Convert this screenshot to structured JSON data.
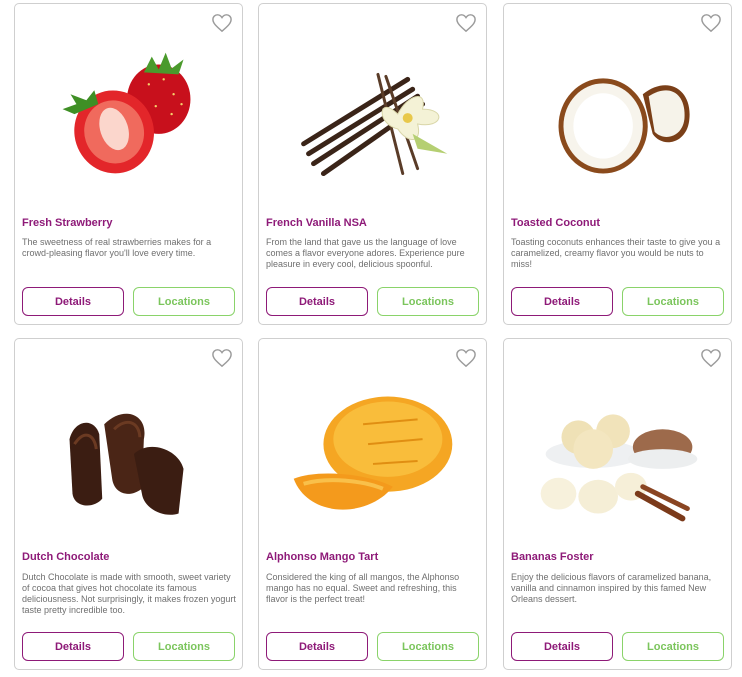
{
  "colors": {
    "title": "#8e1a78",
    "details_border": "#8e1a78",
    "locations_border": "#8ad36a",
    "text": "#6f6f6f"
  },
  "buttons": {
    "details": "Details",
    "locations": "Locations"
  },
  "flavors": [
    {
      "name": "Fresh Strawberry",
      "description": "The sweetness of real strawberries makes for a crowd-pleasing flavor you'll love every time.",
      "image": "strawberry"
    },
    {
      "name": "French Vanilla NSA",
      "description": "From the land that gave us the language of love comes a flavor everyone adores. Experience pure pleasure in every cool, delicious spoonful.",
      "image": "vanilla"
    },
    {
      "name": "Toasted Coconut",
      "description": "Toasting coconuts enhances their taste to give you a caramelized, creamy flavor you would be nuts to miss!",
      "image": "coconut"
    },
    {
      "name": "Dutch Chocolate",
      "description": "Dutch Chocolate is made with smooth, sweet variety of cocoa that gives hot chocolate its famous deliciousness. Not surprisingly, it makes frozen yogurt taste pretty incredible too.",
      "image": "chocolate"
    },
    {
      "name": "Alphonso Mango Tart",
      "description": "Considered the king of all mangos, the Alphonso mango has no equal. Sweet and refreshing, this flavor is the perfect treat!",
      "image": "mango"
    },
    {
      "name": "Bananas Foster",
      "description": "Enjoy the delicious flavors of caramelized banana, vanilla and cinnamon inspired by this famed New Orleans dessert.",
      "image": "bananas"
    }
  ]
}
